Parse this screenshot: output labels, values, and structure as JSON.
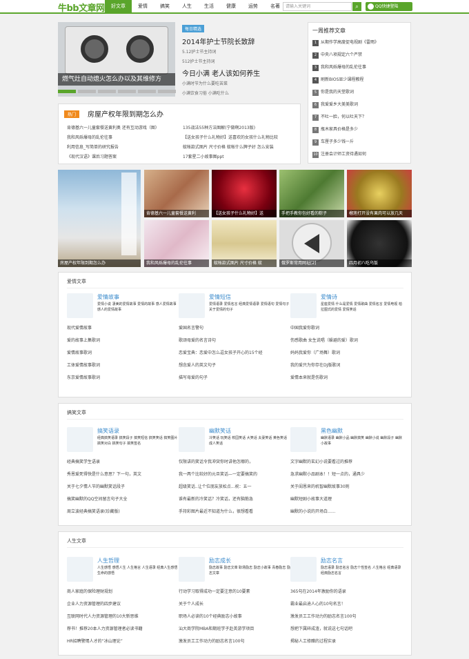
{
  "header": {
    "logo": "牛bb文章网",
    "nav": [
      "好文章",
      "爱情",
      "搞笑",
      "人生",
      "生活",
      "健康",
      "运势",
      "名著"
    ],
    "search_placeholder": "请输入关键词",
    "search_icon": "search-icon",
    "qq": "QQ快捷登陆"
  },
  "slider": {
    "caption": "燃气灶自动熄火怎么办以及其维修方"
  },
  "featured": {
    "tag": "每日精选",
    "title1": "2014年护士节院长致辞",
    "sub1a": "5.12护士节主持词",
    "sub1b": "512护士节主持词",
    "title2": "今日小满 老人该如何养生",
    "sub2a": "小满时节为什么要吃苦菜",
    "sub2b": "小满饮食习俗 小满吃什么"
  },
  "hot": {
    "badge": "热门",
    "title": "房屋产权年限到期怎么办",
    "left": [
      "肯德基六一儿童套餐送黄利奥 还有互动游戏（图）",
      "我和风砾爆母的乱伦往事",
      "利用信息_写简单的研究报告",
      "《现代汉语》课后习题答案"
    ],
    "right": [
      "135战法55种方法图解(宁做啊2013版)",
      "【送女孩子什么礼物好】送喜欢的女孩什么礼物比较",
      "蚊帐款式图片 尺寸价格 蚊帐什么牌子好 怎么安装",
      "17套星二小故事图ppt"
    ]
  },
  "rank": {
    "title": "一周推荐文章",
    "items": [
      "从期作学高度促电视剧《雷雨》",
      "中央八项规定六个严禁",
      "我和风砾爆母的乱伦往事",
      "刷新BIOS显少课程教程",
      "你是我的天堂歌词",
      "我爱爱乡大美美歌词",
      "不吐一脸，何以吐天下？",
      "瓶木家具价格是多少",
      "车厘子多少钱一斤",
      "注册会计师工资待遇如何"
    ]
  },
  "photos": [
    "房屋产权年限到期怎么办",
    "肯德基六一儿童套餐送黄利",
    "【送女孩子什么礼物好】送",
    "手把手教你包好看的粽子",
    "榴莲打开没有果肉可以放几天",
    "我和风砾爆母的乱伦往事",
    "蚊帐款式图片 尺寸价格 蚊",
    "俄罗斯常用网址[2]",
    "四月初八吃乌饭"
  ],
  "sections": [
    {
      "title": "爱情文章",
      "cols": [
        {
          "name": "爱情故事",
          "icon": "mother-child-icon",
          "tags": "爱情小说  凄美的爱情故事  爱情的故事  感人爱情故事  感人的爱情故事",
          "list": [
            "现代爱情故事",
            "爱的故事上集歌词",
            "爱情故事歌词",
            "工体爱情故事歌词",
            "东京爱情故事歌词"
          ]
        },
        {
          "name": "爱情短信",
          "icon": "hearts-icon",
          "tags": "爱情语录  爱情名言  经典爱情语录  爱情语句  爱情句子  关于爱情的句子",
          "list": [
            "爱国名言警句",
            "歌颂母爱的名言诗句",
            "恋爱宝典：恋爱中怎么逗女孩子开心的15个经",
            "想念爱人的英文句子",
            "描写母爱的句子"
          ]
        },
        {
          "name": "爱情诗",
          "icon": "girl-reading-icon",
          "tags": "星座爱情  什么是爱情  爱情歌曲  爱情名言  爱情电视  柏拉图式的爱情  爱情笑话",
          "list": [
            "中国我爱你歌词",
            "伤感歌曲 女生说唱（躲避的爱）歌词",
            "妈妈我爱你（广场舞）歌词",
            "我的爱只为你存在DJ版歌词",
            "爱情本来就是伤歌词"
          ]
        }
      ]
    },
    {
      "title": "搞笑文章",
      "cols": [
        {
          "name": "搞笑语录",
          "icon": "dog-icon",
          "tags": "经典搞笑语录  搞笑段子  搞笑短信  搞笑笑话  搞笑图片  搞笑对白  搞笑句子  搞笑签名",
          "list": [
            "经典搞笑学生语录",
            "秀恩爱死得快是什么意思？下一句，英文",
            "关于七夕情人节的幽默笑话段子",
            "搞笑幽默的QQ空间留言句子大全",
            "周立波经典搞笑语录(珍藏版)"
          ]
        },
        {
          "name": "幽默笑话",
          "icon": "panda-icon",
          "tags": "冷笑话  玩笑话  校园笑话  大笑话  夫妻笑话  黄色笑话  成人笑话",
          "list": [
            "仅限讲的笑话令我冲突你时讲他怎哪的，",
            "我一两个比较好的元旦笑话—一定要搞笑的",
            "超级笑话..让个位朋友放松点...祝：五一",
            "谁有最新的冷笑话？冷笑话，还有脑筋急",
            "手持彩图片最近不知道为什么，很想看看"
          ]
        },
        {
          "name": "黑色幽默",
          "icon": "cartoon-faces-icon",
          "tags": "幽默语录  幽默小品  幽默搞笑  幽默小说  幽默段子  幽默小故事",
          "list": [
            "文字幽默的玄幻小说要看过的推荐",
            "急求幽默小品剧本！！短一点的，通具少",
            "关于闺恩来的机智幽默故事30则",
            "幽默短剧小故事大道理",
            "幽默的小说的开场白......"
          ]
        }
      ]
    },
    {
      "title": "人生文章",
      "cols": [
        {
          "name": "人生哲理",
          "icon": "rabbit-icon",
          "tags": "人生感悟  感悟人生  人生格言  人生语录  经典人生感悟  生命的感悟",
          "list": [
            "商人家庭的保险理财规划",
            "企业人力资源管理的四步建议",
            "互联网时代人力资源管理的10大新思维",
            "荐书！推荐20本人力资源管理者必读书籍",
            "HR招聘警惕人才的“冰山理论”"
          ]
        },
        {
          "name": "励志成长",
          "icon": "cooking-icon",
          "tags": "励志故事  励志文章  职场励志  励志小故事  青春励志  励志文章",
          "list": [
            "行动学习取得成功一定要注意的10要素",
            "关于个人成长",
            "职场人必读的10个经典励志小故事",
            "汕大商学院MBA和期班学子赴英游学项目",
            "激发员工工作动力的励志名言100句"
          ]
        },
        {
          "name": "励志名言",
          "icon": "tree-icon",
          "tags": "励志语录  励志名言  励志个性签名  人生格言  经典语录  经典励志名言",
          "list": [
            "365句在2014年激励你的语录",
            "霸业最启迪人心的10句名言！",
            "激发员工工作动力的励志名言100句",
            "想把下属碎成渣，就说这七句话吧",
            "揭秘人工修醋的过程实录"
          ]
        }
      ]
    }
  ],
  "colors": {
    "accent": "#5aa52b",
    "link_blue": "#3a8acb",
    "hot_orange": "#f08a1d"
  }
}
